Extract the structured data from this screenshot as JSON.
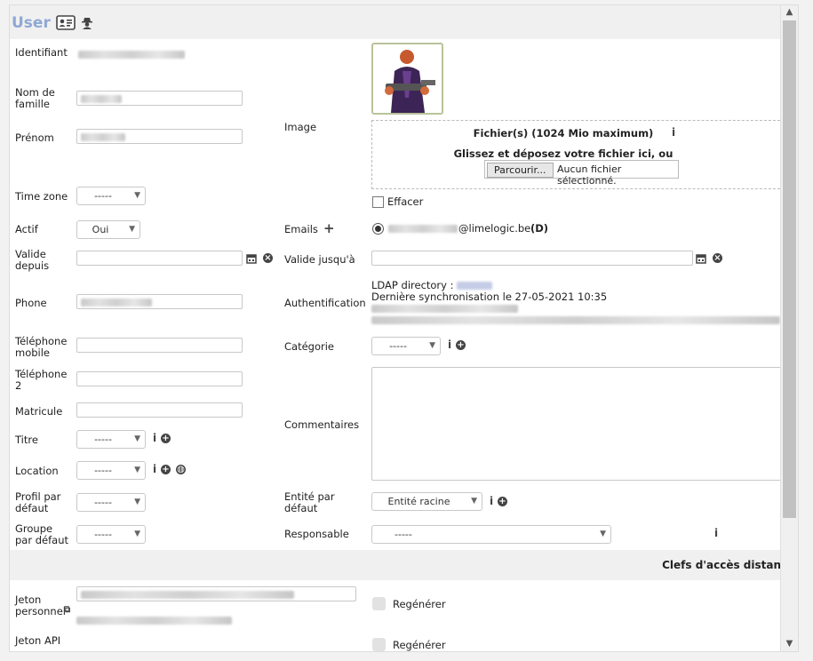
{
  "header": {
    "title": "User"
  },
  "left": {
    "identifiant_label": "Identifiant",
    "nom_label": "Nom de famille",
    "prenom_label": "Prénom",
    "timezone_label": "Time zone",
    "timezone_value": "-----",
    "actif_label": "Actif",
    "actif_value": "Oui",
    "valide_depuis_label": "Valide depuis",
    "phone_label": "Phone",
    "tel_mobile_label": "Téléphone mobile",
    "tel2_label": "Téléphone 2",
    "matricule_label": "Matricule",
    "titre_label": "Titre",
    "titre_value": "-----",
    "location_label": "Location",
    "location_value": "-----",
    "profil_label": "Profil par défaut",
    "profil_value": "-----",
    "groupe_label": "Groupe par défaut",
    "groupe_value": "-----"
  },
  "right": {
    "image_label": "Image",
    "file_title": "Fichier(s) (1024 Mio maximum)",
    "drop_text": "Glissez et déposez votre fichier ici, ou",
    "browse_label": "Parcourir...",
    "no_file_text": "Aucun fichier sélectionné.",
    "effacer_label": "Effacer",
    "emails_label": "Emails",
    "email_domain": "@limelogic.be",
    "email_default": "(D)",
    "valide_jusqua_label": "Valide jusqu'à",
    "auth_label": "Authentification",
    "ldap_label": "LDAP directory :",
    "sync_text": "Dernière synchronisation le 27-05-2021 10:35",
    "categorie_label": "Catégorie",
    "categorie_value": "-----",
    "commentaires_label": "Commentaires",
    "entite_label": "Entité par défaut",
    "entite_value": "Entité racine",
    "responsable_label": "Responsable",
    "responsable_value": "-----"
  },
  "section": {
    "title": "Clefs d'accès distan"
  },
  "tokens": {
    "jeton_perso_label": "Jeton personnel",
    "regenerer_label": "Regénérer",
    "jeton_api_label": "Jeton API",
    "regenerer2_label": "Regénérer"
  }
}
